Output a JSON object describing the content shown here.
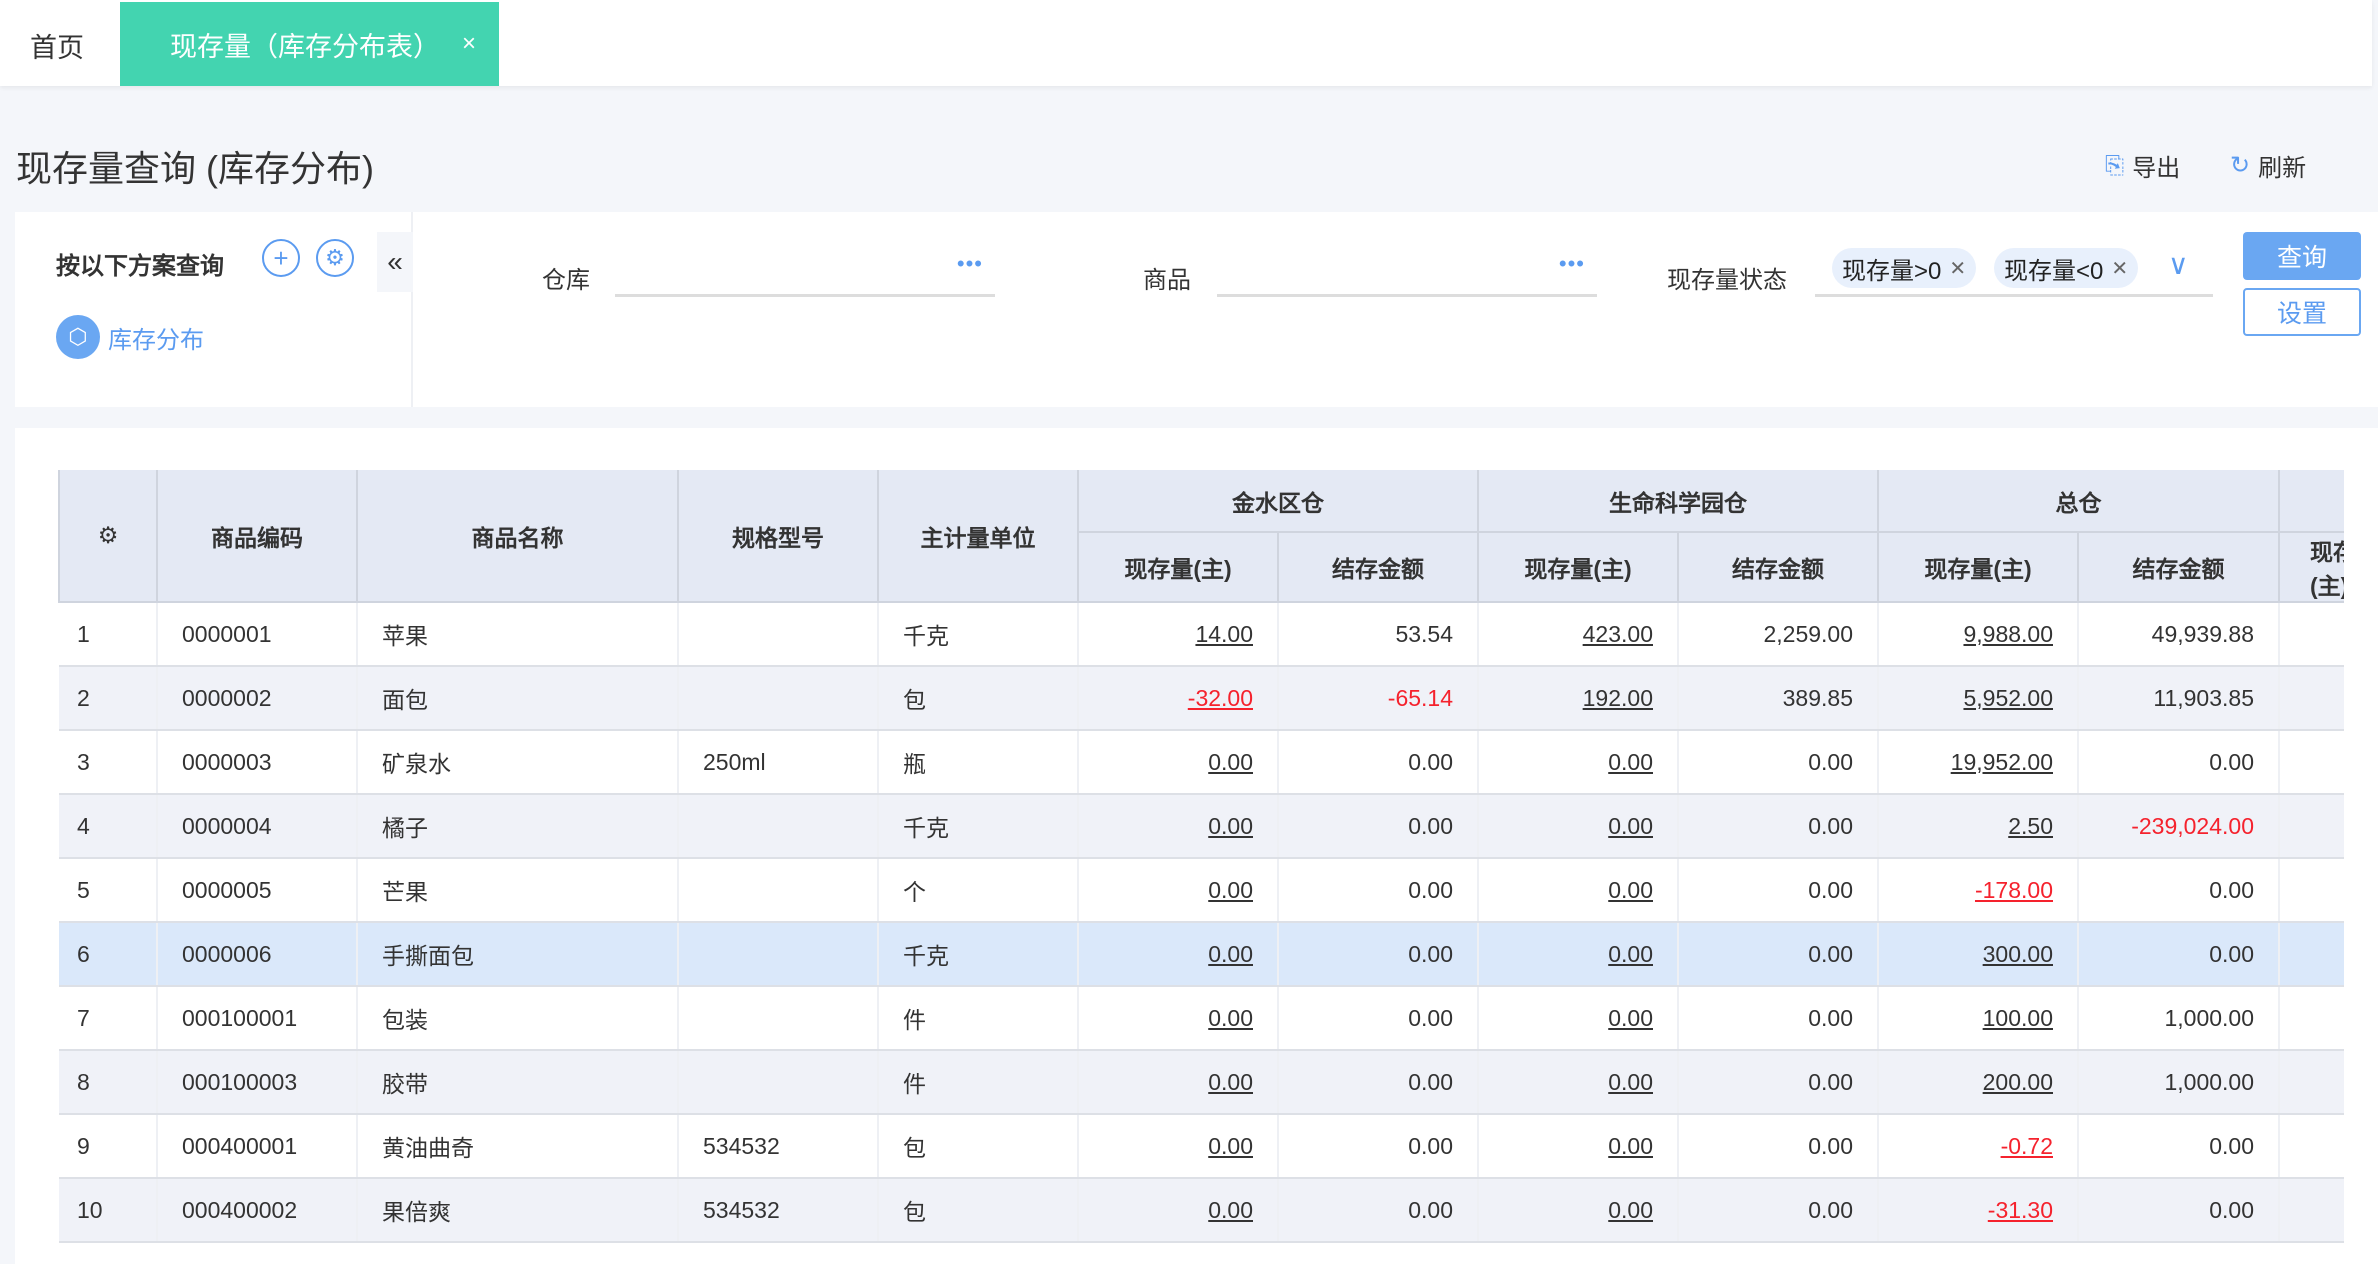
{
  "tabs": {
    "home": "首页",
    "active": "现存量（库存分布表）",
    "close": "×"
  },
  "page": {
    "title": "现存量查询 (库存分布)",
    "export": "导出",
    "refresh": "刷新"
  },
  "scheme": {
    "label": "按以下方案查询",
    "item": "库存分布"
  },
  "filters": {
    "warehouse_label": "仓库",
    "warehouse_value": "",
    "product_label": "商品",
    "product_value": "",
    "status_label": "现存量状态",
    "chips": [
      "现存量>0",
      "现存量<0"
    ],
    "query": "查询",
    "settings": "设置"
  },
  "colors": {
    "accent": "#43d4b0",
    "primary": "#6aa7f2",
    "negative": "#f5222d"
  },
  "table": {
    "headers": [
      "商品编码",
      "商品名称",
      "规格型号",
      "主计量单位"
    ],
    "groups": [
      "金水区仓",
      "生命科学园仓",
      "总仓",
      ""
    ],
    "sub_headers": [
      "现存量(主)",
      "结存金额"
    ],
    "selected_row": 6,
    "rows": [
      {
        "no": "1",
        "code": "0000001",
        "name": "苹果",
        "spec": "",
        "unit": "千克",
        "v": [
          "14.00",
          "53.54",
          "423.00",
          "2,259.00",
          "9,988.00",
          "49,939.88"
        ]
      },
      {
        "no": "2",
        "code": "0000002",
        "name": "面包",
        "spec": "",
        "unit": "包",
        "v": [
          "-32.00",
          "-65.14",
          "192.00",
          "389.85",
          "5,952.00",
          "11,903.85"
        ]
      },
      {
        "no": "3",
        "code": "0000003",
        "name": "矿泉水",
        "spec": "250ml",
        "unit": "瓶",
        "v": [
          "0.00",
          "0.00",
          "0.00",
          "0.00",
          "19,952.00",
          "0.00"
        ]
      },
      {
        "no": "4",
        "code": "0000004",
        "name": "橘子",
        "spec": "",
        "unit": "千克",
        "v": [
          "0.00",
          "0.00",
          "0.00",
          "0.00",
          "2.50",
          "-239,024.00"
        ]
      },
      {
        "no": "5",
        "code": "0000005",
        "name": "芒果",
        "spec": "",
        "unit": "个",
        "v": [
          "0.00",
          "0.00",
          "0.00",
          "0.00",
          "-178.00",
          "0.00"
        ]
      },
      {
        "no": "6",
        "code": "0000006",
        "name": "手撕面包",
        "spec": "",
        "unit": "千克",
        "v": [
          "0.00",
          "0.00",
          "0.00",
          "0.00",
          "300.00",
          "0.00"
        ]
      },
      {
        "no": "7",
        "code": "000100001",
        "name": "包装",
        "spec": "",
        "unit": "件",
        "v": [
          "0.00",
          "0.00",
          "0.00",
          "0.00",
          "100.00",
          "1,000.00"
        ]
      },
      {
        "no": "8",
        "code": "000100003",
        "name": "胶带",
        "spec": "",
        "unit": "件",
        "v": [
          "0.00",
          "0.00",
          "0.00",
          "0.00",
          "200.00",
          "1,000.00"
        ]
      },
      {
        "no": "9",
        "code": "000400001",
        "name": "黄油曲奇",
        "spec": "534532",
        "unit": "包",
        "v": [
          "0.00",
          "0.00",
          "0.00",
          "0.00",
          "-0.72",
          "0.00"
        ]
      },
      {
        "no": "10",
        "code": "000400002",
        "name": "果倍爽",
        "spec": "534532",
        "unit": "包",
        "v": [
          "0.00",
          "0.00",
          "0.00",
          "0.00",
          "-31.30",
          "0.00"
        ]
      }
    ]
  }
}
